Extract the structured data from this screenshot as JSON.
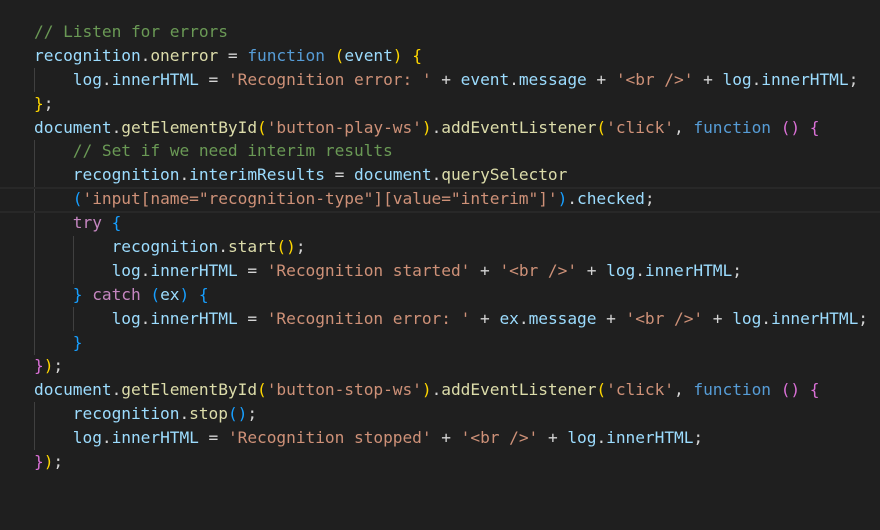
{
  "editor": {
    "theme_colors": {
      "background": "#1f1f1f",
      "comment": "#6a9955",
      "variable": "#9cdcfe",
      "keyword": "#569cd6",
      "control_keyword": "#c586c0",
      "string": "#ce9178",
      "function": "#dcdcaa",
      "text": "#d4d4d4",
      "bracket_level_1": "#ffd700",
      "bracket_level_2": "#da70d6",
      "bracket_level_3": "#179fff"
    },
    "current_line": 8,
    "lines": [
      {
        "tokens": [
          {
            "c": "t-com",
            "t": "// Listen for errors"
          }
        ]
      },
      {
        "tokens": [
          {
            "c": "t-var",
            "t": "recognition"
          },
          {
            "c": "t-op",
            "t": "."
          },
          {
            "c": "t-fn",
            "t": "onerror"
          },
          {
            "c": "t-op",
            "t": " = "
          },
          {
            "c": "t-kw",
            "t": "function"
          },
          {
            "c": "t-op",
            "t": " "
          },
          {
            "c": "b1",
            "t": "("
          },
          {
            "c": "t-var",
            "t": "event"
          },
          {
            "c": "b1",
            "t": ")"
          },
          {
            "c": "t-op",
            "t": " "
          },
          {
            "c": "b1",
            "t": "{"
          }
        ]
      },
      {
        "tokens": [
          {
            "c": "t-op",
            "t": "    "
          },
          {
            "c": "t-var",
            "t": "log"
          },
          {
            "c": "t-op",
            "t": "."
          },
          {
            "c": "t-var",
            "t": "innerHTML"
          },
          {
            "c": "t-op",
            "t": " = "
          },
          {
            "c": "t-str",
            "t": "'Recognition error: '"
          },
          {
            "c": "t-op",
            "t": " + "
          },
          {
            "c": "t-var",
            "t": "event"
          },
          {
            "c": "t-op",
            "t": "."
          },
          {
            "c": "t-var",
            "t": "message"
          },
          {
            "c": "t-op",
            "t": " + "
          },
          {
            "c": "t-str",
            "t": "'<br />'"
          },
          {
            "c": "t-op",
            "t": " + "
          },
          {
            "c": "t-var",
            "t": "log"
          },
          {
            "c": "t-op",
            "t": "."
          },
          {
            "c": "t-var",
            "t": "innerHTML"
          },
          {
            "c": "t-op",
            "t": ";"
          }
        ]
      },
      {
        "tokens": [
          {
            "c": "b1",
            "t": "}"
          },
          {
            "c": "t-op",
            "t": ";"
          }
        ]
      },
      {
        "tokens": [
          {
            "c": "t-var",
            "t": "document"
          },
          {
            "c": "t-op",
            "t": "."
          },
          {
            "c": "t-fn",
            "t": "getElementById"
          },
          {
            "c": "b1",
            "t": "("
          },
          {
            "c": "t-str",
            "t": "'button-play-ws'"
          },
          {
            "c": "b1",
            "t": ")"
          },
          {
            "c": "t-op",
            "t": "."
          },
          {
            "c": "t-fn",
            "t": "addEventListener"
          },
          {
            "c": "b1",
            "t": "("
          },
          {
            "c": "t-str",
            "t": "'click'"
          },
          {
            "c": "t-op",
            "t": ", "
          },
          {
            "c": "t-kw",
            "t": "function"
          },
          {
            "c": "t-op",
            "t": " "
          },
          {
            "c": "b2",
            "t": "()"
          },
          {
            "c": "t-op",
            "t": " "
          },
          {
            "c": "b2",
            "t": "{"
          }
        ]
      },
      {
        "tokens": [
          {
            "c": "t-op",
            "t": "    "
          },
          {
            "c": "t-com",
            "t": "// Set if we need interim results"
          }
        ]
      },
      {
        "tokens": [
          {
            "c": "t-op",
            "t": "    "
          },
          {
            "c": "t-var",
            "t": "recognition"
          },
          {
            "c": "t-op",
            "t": "."
          },
          {
            "c": "t-var",
            "t": "interimResults"
          },
          {
            "c": "t-op",
            "t": " = "
          },
          {
            "c": "t-var",
            "t": "document"
          },
          {
            "c": "t-op",
            "t": "."
          },
          {
            "c": "t-fn",
            "t": "querySelector"
          }
        ]
      },
      {
        "tokens": [
          {
            "c": "t-op",
            "t": "    "
          },
          {
            "c": "b3",
            "t": "("
          },
          {
            "c": "t-str",
            "t": "'input[name=\"recognition-type\"][value=\"interim\"]'"
          },
          {
            "c": "b3",
            "t": ")"
          },
          {
            "c": "t-op",
            "t": "."
          },
          {
            "c": "t-var",
            "t": "checked"
          },
          {
            "c": "t-op",
            "t": ";"
          }
        ]
      },
      {
        "tokens": [
          {
            "c": "t-op",
            "t": "    "
          },
          {
            "c": "t-ctl",
            "t": "try"
          },
          {
            "c": "t-op",
            "t": " "
          },
          {
            "c": "b3",
            "t": "{"
          }
        ]
      },
      {
        "tokens": [
          {
            "c": "t-op",
            "t": "        "
          },
          {
            "c": "t-var",
            "t": "recognition"
          },
          {
            "c": "t-op",
            "t": "."
          },
          {
            "c": "t-fn",
            "t": "start"
          },
          {
            "c": "b1",
            "t": "()"
          },
          {
            "c": "t-op",
            "t": ";"
          }
        ]
      },
      {
        "tokens": [
          {
            "c": "t-op",
            "t": "        "
          },
          {
            "c": "t-var",
            "t": "log"
          },
          {
            "c": "t-op",
            "t": "."
          },
          {
            "c": "t-var",
            "t": "innerHTML"
          },
          {
            "c": "t-op",
            "t": " = "
          },
          {
            "c": "t-str",
            "t": "'Recognition started'"
          },
          {
            "c": "t-op",
            "t": " + "
          },
          {
            "c": "t-str",
            "t": "'<br />'"
          },
          {
            "c": "t-op",
            "t": " + "
          },
          {
            "c": "t-var",
            "t": "log"
          },
          {
            "c": "t-op",
            "t": "."
          },
          {
            "c": "t-var",
            "t": "innerHTML"
          },
          {
            "c": "t-op",
            "t": ";"
          }
        ]
      },
      {
        "tokens": [
          {
            "c": "t-op",
            "t": "    "
          },
          {
            "c": "b3",
            "t": "}"
          },
          {
            "c": "t-op",
            "t": " "
          },
          {
            "c": "t-ctl",
            "t": "catch"
          },
          {
            "c": "t-op",
            "t": " "
          },
          {
            "c": "b3",
            "t": "("
          },
          {
            "c": "t-var",
            "t": "ex"
          },
          {
            "c": "b3",
            "t": ")"
          },
          {
            "c": "t-op",
            "t": " "
          },
          {
            "c": "b3",
            "t": "{"
          }
        ]
      },
      {
        "tokens": [
          {
            "c": "t-op",
            "t": "        "
          },
          {
            "c": "t-var",
            "t": "log"
          },
          {
            "c": "t-op",
            "t": "."
          },
          {
            "c": "t-var",
            "t": "innerHTML"
          },
          {
            "c": "t-op",
            "t": " = "
          },
          {
            "c": "t-str",
            "t": "'Recognition error: '"
          },
          {
            "c": "t-op",
            "t": " + "
          },
          {
            "c": "t-var",
            "t": "ex"
          },
          {
            "c": "t-op",
            "t": "."
          },
          {
            "c": "t-var",
            "t": "message"
          },
          {
            "c": "t-op",
            "t": " + "
          },
          {
            "c": "t-str",
            "t": "'<br />'"
          },
          {
            "c": "t-op",
            "t": " + "
          },
          {
            "c": "t-var",
            "t": "log"
          },
          {
            "c": "t-op",
            "t": "."
          },
          {
            "c": "t-var",
            "t": "innerHTML"
          },
          {
            "c": "t-op",
            "t": ";"
          }
        ]
      },
      {
        "tokens": [
          {
            "c": "t-op",
            "t": "    "
          },
          {
            "c": "b3",
            "t": "}"
          }
        ]
      },
      {
        "tokens": [
          {
            "c": "b2",
            "t": "}"
          },
          {
            "c": "b1",
            "t": ")"
          },
          {
            "c": "t-op",
            "t": ";"
          }
        ]
      },
      {
        "tokens": [
          {
            "c": "t-var",
            "t": "document"
          },
          {
            "c": "t-op",
            "t": "."
          },
          {
            "c": "t-fn",
            "t": "getElementById"
          },
          {
            "c": "b1",
            "t": "("
          },
          {
            "c": "t-str",
            "t": "'button-stop-ws'"
          },
          {
            "c": "b1",
            "t": ")"
          },
          {
            "c": "t-op",
            "t": "."
          },
          {
            "c": "t-fn",
            "t": "addEventListener"
          },
          {
            "c": "b1",
            "t": "("
          },
          {
            "c": "t-str",
            "t": "'click'"
          },
          {
            "c": "t-op",
            "t": ", "
          },
          {
            "c": "t-kw",
            "t": "function"
          },
          {
            "c": "t-op",
            "t": " "
          },
          {
            "c": "b2",
            "t": "()"
          },
          {
            "c": "t-op",
            "t": " "
          },
          {
            "c": "b2",
            "t": "{"
          }
        ]
      },
      {
        "tokens": [
          {
            "c": "t-op",
            "t": "    "
          },
          {
            "c": "t-var",
            "t": "recognition"
          },
          {
            "c": "t-op",
            "t": "."
          },
          {
            "c": "t-fn",
            "t": "stop"
          },
          {
            "c": "b3",
            "t": "()"
          },
          {
            "c": "t-op",
            "t": ";"
          }
        ]
      },
      {
        "tokens": [
          {
            "c": "t-op",
            "t": "    "
          },
          {
            "c": "t-var",
            "t": "log"
          },
          {
            "c": "t-op",
            "t": "."
          },
          {
            "c": "t-var",
            "t": "innerHTML"
          },
          {
            "c": "t-op",
            "t": " = "
          },
          {
            "c": "t-str",
            "t": "'Recognition stopped'"
          },
          {
            "c": "t-op",
            "t": " + "
          },
          {
            "c": "t-str",
            "t": "'<br />'"
          },
          {
            "c": "t-op",
            "t": " + "
          },
          {
            "c": "t-var",
            "t": "log"
          },
          {
            "c": "t-op",
            "t": "."
          },
          {
            "c": "t-var",
            "t": "innerHTML"
          },
          {
            "c": "t-op",
            "t": ";"
          }
        ]
      },
      {
        "tokens": [
          {
            "c": "b2",
            "t": "}"
          },
          {
            "c": "b1",
            "t": ")"
          },
          {
            "c": "t-op",
            "t": ";"
          }
        ]
      }
    ]
  }
}
